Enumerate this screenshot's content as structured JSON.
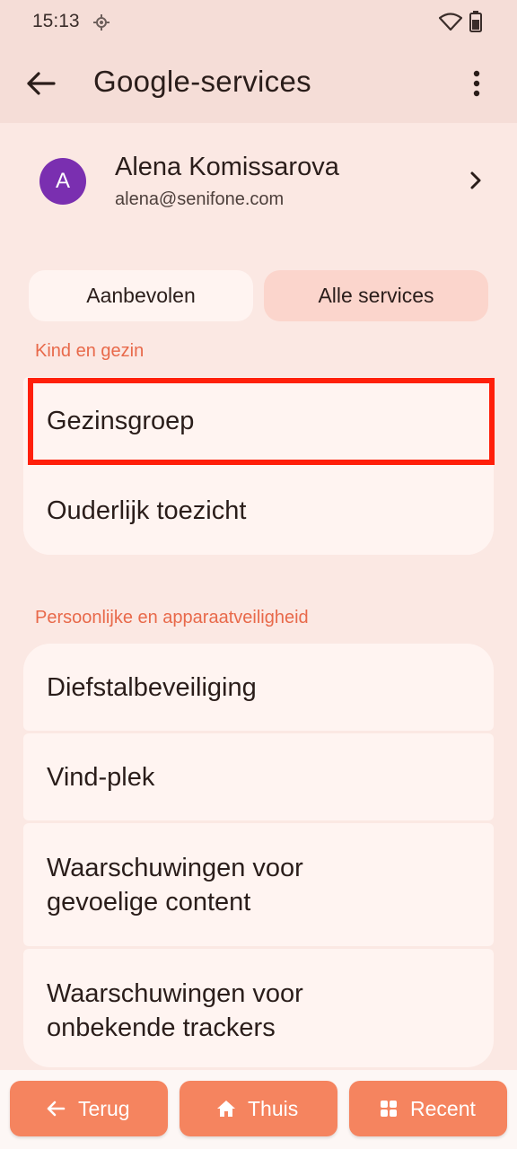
{
  "status_bar": {
    "time": "15:13"
  },
  "app_bar": {
    "title": "Google-services"
  },
  "account": {
    "avatar_letter": "A",
    "name": "Alena Komissarova",
    "email": "alena@senifone.com"
  },
  "tabs": [
    {
      "label": "Aanbevolen",
      "selected": false
    },
    {
      "label": "Alle services",
      "selected": true
    }
  ],
  "sections": [
    {
      "header": "Kind en gezin",
      "items": [
        "Gezinsgroep",
        "Ouderlijk toezicht"
      ]
    },
    {
      "header": "Persoonlijke en apparaatveiligheid",
      "items": [
        "Diefstalbeveiliging",
        "Vind-plek",
        "Waarschuwingen voor gevoelige content",
        "Waarschuwingen voor onbekende trackers"
      ]
    }
  ],
  "bottom_nav": {
    "back_label": "Terug",
    "home_label": "Thuis",
    "recent_label": "Recent"
  },
  "colors": {
    "accent": "#e8694a",
    "nav_button": "#f5845f",
    "highlight": "#ff1f0a",
    "avatar": "#7a2fb0"
  }
}
